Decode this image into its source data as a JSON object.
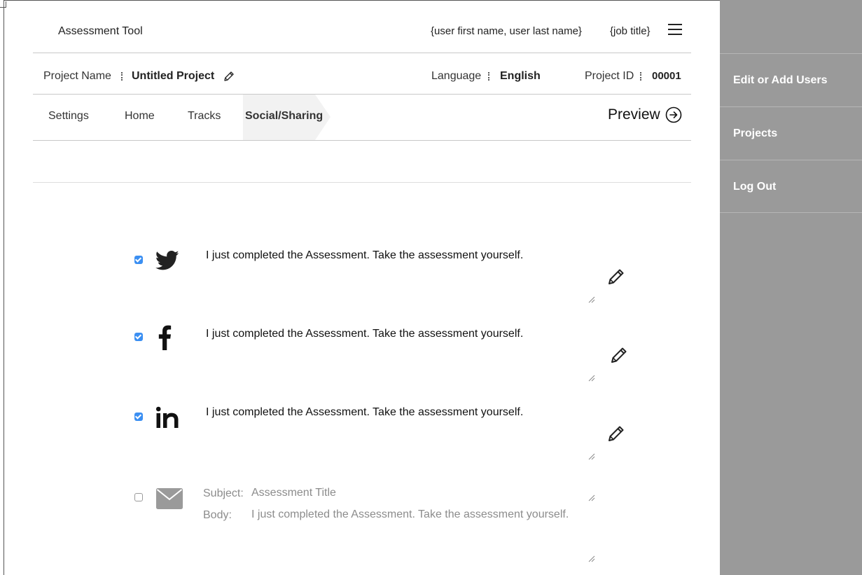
{
  "header": {
    "app_title": "Assessment Tool",
    "user_name": "{user first name, user last name}",
    "job_title": "{job title}"
  },
  "project_bar": {
    "name_label": "Project Name",
    "name_value": "Untitled Project",
    "language_label": "Language",
    "language_value": "English",
    "id_label": "Project ID",
    "id_value": "00001"
  },
  "tabs": [
    {
      "label": "Settings",
      "active": false
    },
    {
      "label": "Home",
      "active": false
    },
    {
      "label": "Tracks",
      "active": false
    },
    {
      "label": "Social/Sharing",
      "active": true
    }
  ],
  "preview_label": "Preview",
  "share_rows": [
    {
      "network": "twitter-icon",
      "checked": true,
      "text": "I just completed the Assessment. Take the assessment yourself."
    },
    {
      "network": "facebook-icon",
      "checked": true,
      "text": "I just completed the Assessment. Take the assessment yourself."
    },
    {
      "network": "linkedin-icon",
      "checked": true,
      "text": "I just completed the Assessment. Take the assessment yourself."
    }
  ],
  "email_row": {
    "checked": false,
    "icon": "envelope-icon",
    "subject_label": "Subject:",
    "subject_placeholder": "Assessment Title",
    "body_label": "Body:",
    "body_placeholder": "I just completed the Assessment. Take the assessment yourself."
  },
  "drawer": {
    "items": [
      {
        "label": "Edit or Add Users"
      },
      {
        "label": "Projects"
      },
      {
        "label": "Log Out"
      }
    ]
  },
  "colors": {
    "drawer_bg": "#9a9a9a",
    "checkbox_accent": "#3b8ff2",
    "active_tab_bg": "#f2f2f2"
  }
}
